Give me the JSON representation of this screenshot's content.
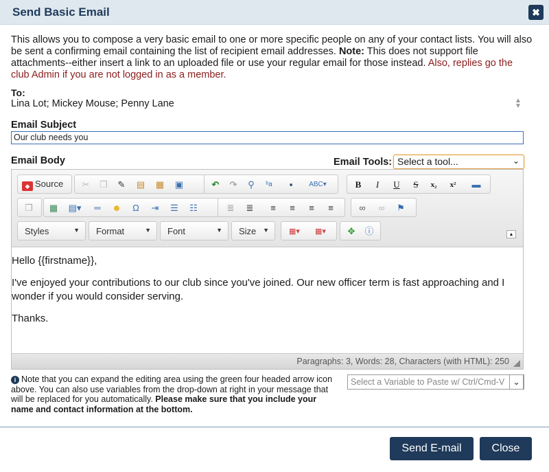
{
  "dialog": {
    "title": "Send Basic Email",
    "close_glyph": "✖"
  },
  "intro": {
    "text1": "This allows you to compose a very basic email to one or more specific people on any of your contact lists. You will also be sent a confirming email containing the list of recipient email addresses. ",
    "note_label": "Note:",
    "text2": " This does not support file attachments--either insert a link to an uploaded file or use your regular email for those instead. ",
    "red_text": "Also, replies go the club Admin if you are not logged in as a member."
  },
  "to": {
    "label": "To:",
    "value": "Lina Lot; Mickey Mouse; Penny Lane"
  },
  "subject": {
    "label": "Email Subject",
    "value": "Our club needs you"
  },
  "body": {
    "label": "Email Body"
  },
  "tools": {
    "label": "Email Tools:",
    "selected": "Select a tool..."
  },
  "toolbar": {
    "source_label": "Source",
    "styles_label": "Styles",
    "format_label": "Format",
    "font_label": "Font",
    "size_label": "Size",
    "bold": "B",
    "italic": "I",
    "underline": "U",
    "strike": "S",
    "subscript": "x₂",
    "superscript": "x²",
    "omega": "Ω"
  },
  "content": {
    "line1": "Hello {{firstname}},",
    "line2": "I've enjoyed your contributions to our club since you've joined. Our new officer term is fast approaching and I wonder if you would consider serving.",
    "line3": "Thanks."
  },
  "status": {
    "text": "Paragraphs: 3, Words: 28, Characters (with HTML): 250"
  },
  "note": {
    "info_glyph": "i",
    "text": "Note that you can expand the editing area using the green four headed arrow icon above. You can also use variables from the drop-down at right in your message that will be replaced for you automatically. ",
    "bold_text": "Please make sure that you include your name and contact information at the bottom."
  },
  "variable_select": {
    "placeholder": "Select a Variable to Paste w/ Ctrl/Cmd-V"
  },
  "buttons": {
    "send": "Send E-mail",
    "close": "Close"
  },
  "colors": {
    "brand": "#1f3a5a",
    "red_text": "#8b1c1c",
    "focus": "#e2a04a"
  }
}
